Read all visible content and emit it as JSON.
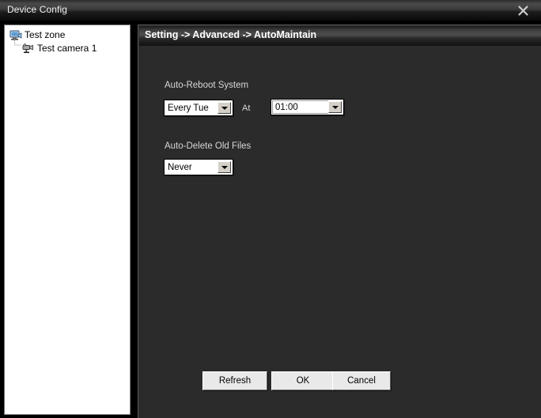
{
  "window": {
    "title": "Device Config",
    "close_icon": "close-x-icon"
  },
  "tree": {
    "nodes": [
      {
        "label": "Test zone",
        "icon": "zone-monitor-icon",
        "level": 0
      },
      {
        "label": "Test camera 1",
        "icon": "camera-icon",
        "level": 1
      }
    ]
  },
  "content": {
    "breadcrumb": "Setting -> Advanced -> AutoMaintain",
    "groups": [
      {
        "label": "Auto-Reboot System",
        "schedule_value": "Every Tue",
        "at_label": "At",
        "time_value": "01:00"
      },
      {
        "label": "Auto-Delete Old Files",
        "delete_value": "Never"
      }
    ],
    "buttons": {
      "refresh": "Refresh",
      "ok": "OK",
      "cancel": "Cancel"
    }
  },
  "colors": {
    "window_bg": "#000000",
    "panel_bg": "#2b2b2b",
    "tree_bg": "#ffffff",
    "label_text": "#d8d8d8",
    "title_text": "#f2f2f2",
    "button_face": "#e9e9e9"
  }
}
